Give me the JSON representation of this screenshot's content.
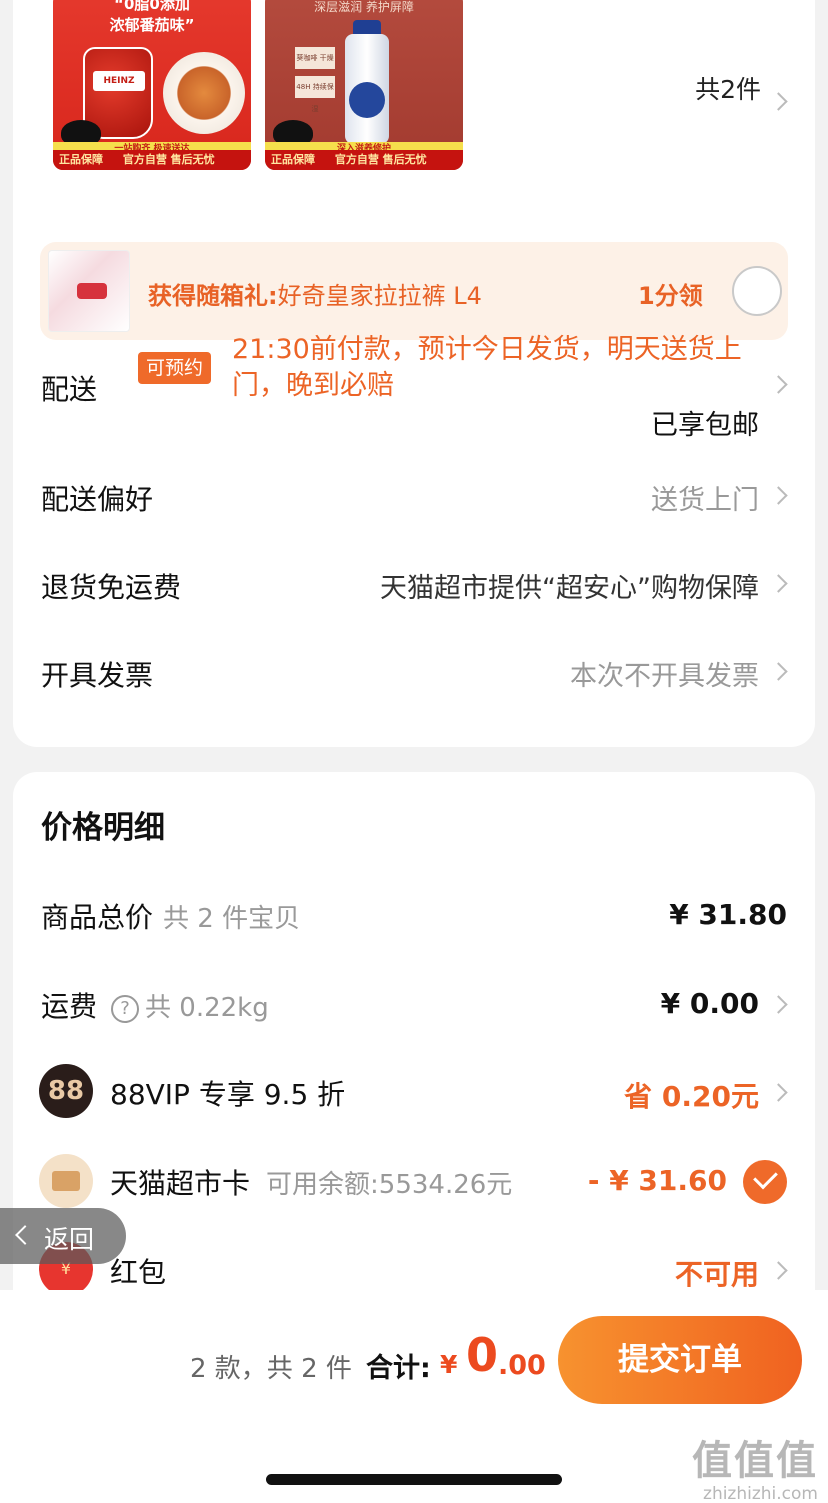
{
  "products": {
    "item1": {
      "headline1": "“0脂0添加",
      "headline2": "浓郁番茄味”",
      "pack_label": "HEINZ",
      "strip": "一站购齐 极速送达",
      "foot_left": "正品保障",
      "foot_right": "官方自营 售后无忧"
    },
    "item2": {
      "headline": "深层滋润 养护屏障",
      "tag1": "葵咖啡 干燥肌",
      "tag2": "48H 持续保湿",
      "strip": "深入滋养修护",
      "foot_left": "正品保障",
      "foot_right": "官方自营 售后无忧"
    },
    "count": "共2件"
  },
  "gift": {
    "label": "获得随箱礼:",
    "name": "好奇皇家拉拉裤 L4",
    "price": "1分领"
  },
  "delivery": {
    "label": "配送",
    "badge": "可预约",
    "text": "21:30前付款，预计今日发货，明天送货上门，晚到必赔",
    "free": "已享包邮"
  },
  "preference": {
    "label": "配送偏好",
    "value": "送货上门"
  },
  "returns": {
    "label": "退货免运费",
    "value": "天猫超市提供“超安心”购物保障"
  },
  "invoice": {
    "label": "开具发票",
    "value": "本次不开具发票"
  },
  "price_detail": {
    "title": "价格明细",
    "subtotal": {
      "label": "商品总价",
      "sub": "共 2 件宝贝",
      "amount": "¥ 31.80"
    },
    "shipping": {
      "label": "运费",
      "sub": "共 0.22kg",
      "amount": "¥ 0.00",
      "help": "?"
    },
    "vip": {
      "icon": "88",
      "label": "88VIP 专享 9.5 折",
      "amount": "省 0.20元"
    },
    "card": {
      "label": "天猫超市卡",
      "sub": "可用余额:5534.26元",
      "amount": "- ¥ 31.60"
    },
    "redpacket": {
      "icon": "¥",
      "label": "红包",
      "amount": "不可用"
    }
  },
  "back": {
    "label": "返回"
  },
  "bottom": {
    "summary": "2 款，共 2 件",
    "total_label": "合计:",
    "yen": "¥",
    "total_int": "0",
    "total_dec": ".00",
    "submit": "提交订单"
  },
  "watermark": {
    "logo": "值值值",
    "url": "zhizhizhi.com"
  },
  "colors": {
    "accent": "#ec6426",
    "button_start": "#f7922f",
    "button_end": "#f06220"
  }
}
